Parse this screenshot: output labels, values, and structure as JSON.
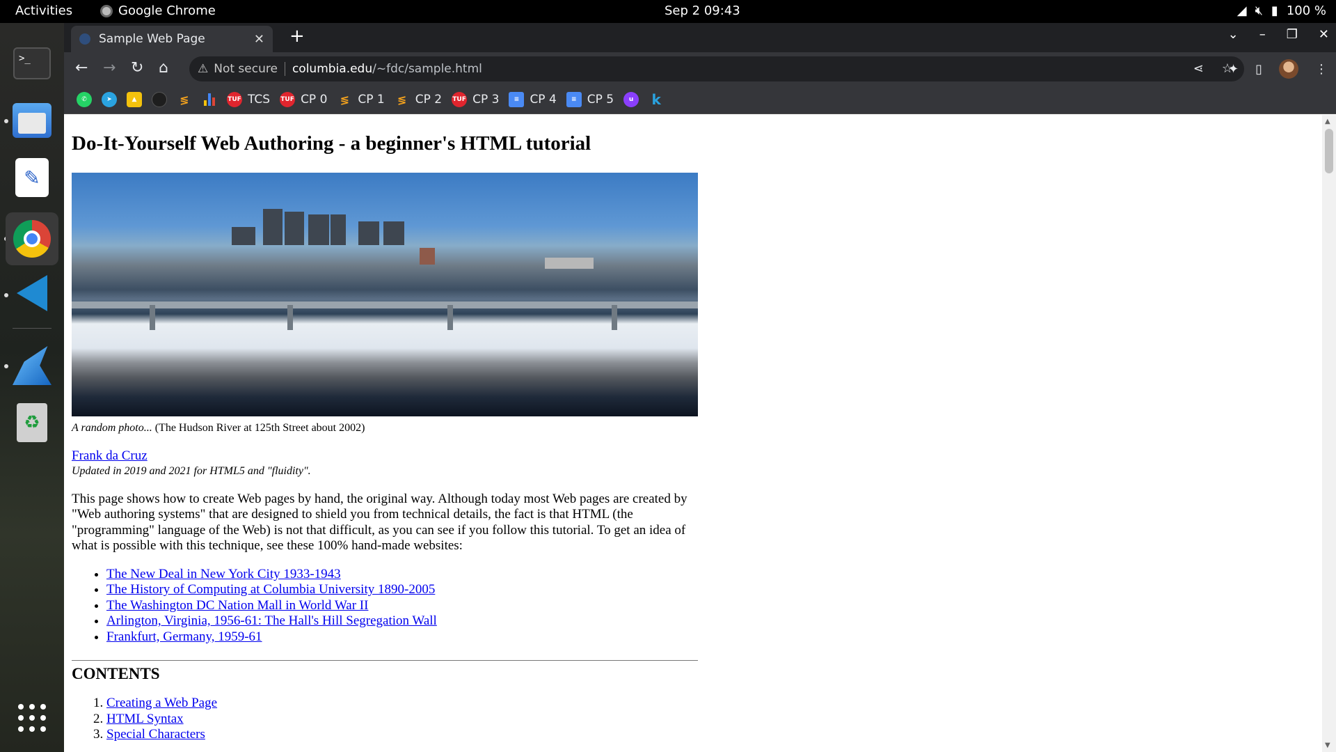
{
  "system": {
    "activities": "Activities",
    "app_name": "Google Chrome",
    "clock": "Sep 2  09:43",
    "battery": "100 %"
  },
  "browser": {
    "tab_title": "Sample Web Page",
    "security_label": "Not secure",
    "url_host": "columbia.edu",
    "url_path": "/~fdc/sample.html",
    "bookmarks": [
      "TCS",
      "CP 0",
      "CP 1",
      "CP 2",
      "CP 3",
      "CP 4",
      "CP 5"
    ]
  },
  "page": {
    "title": "Do-It-Yourself Web Authoring - a beginner's HTML tutorial",
    "caption_italic": "A random photo...",
    "caption_rest": " (The Hudson River at 125th Street about 2002)",
    "author": "Frank da Cruz",
    "updated": "Updated in 2019 and 2021 for HTML5 and \"fluidity\".",
    "intro": "This page shows how to create Web pages by hand, the original way. Although today most Web pages are created by \"Web authoring systems\" that are designed to shield you from technical details, the fact is that HTML (the \"programming\" language of the Web) is not that difficult, as you can see if you follow this tutorial. To get an idea of what is possible with this technique, see these 100% hand-made websites:",
    "links": [
      "The New Deal in New York City 1933-1943",
      "The History of Computing at Columbia University 1890-2005",
      "The Washington DC Nation Mall in World War II",
      "Arlington, Virginia, 1956-61: The Hall's Hill Segregation Wall",
      "Frankfurt, Germany, 1959-61"
    ],
    "contents_heading": "CONTENTS",
    "toc": [
      "Creating a Web Page",
      "HTML Syntax",
      "Special Characters"
    ]
  }
}
